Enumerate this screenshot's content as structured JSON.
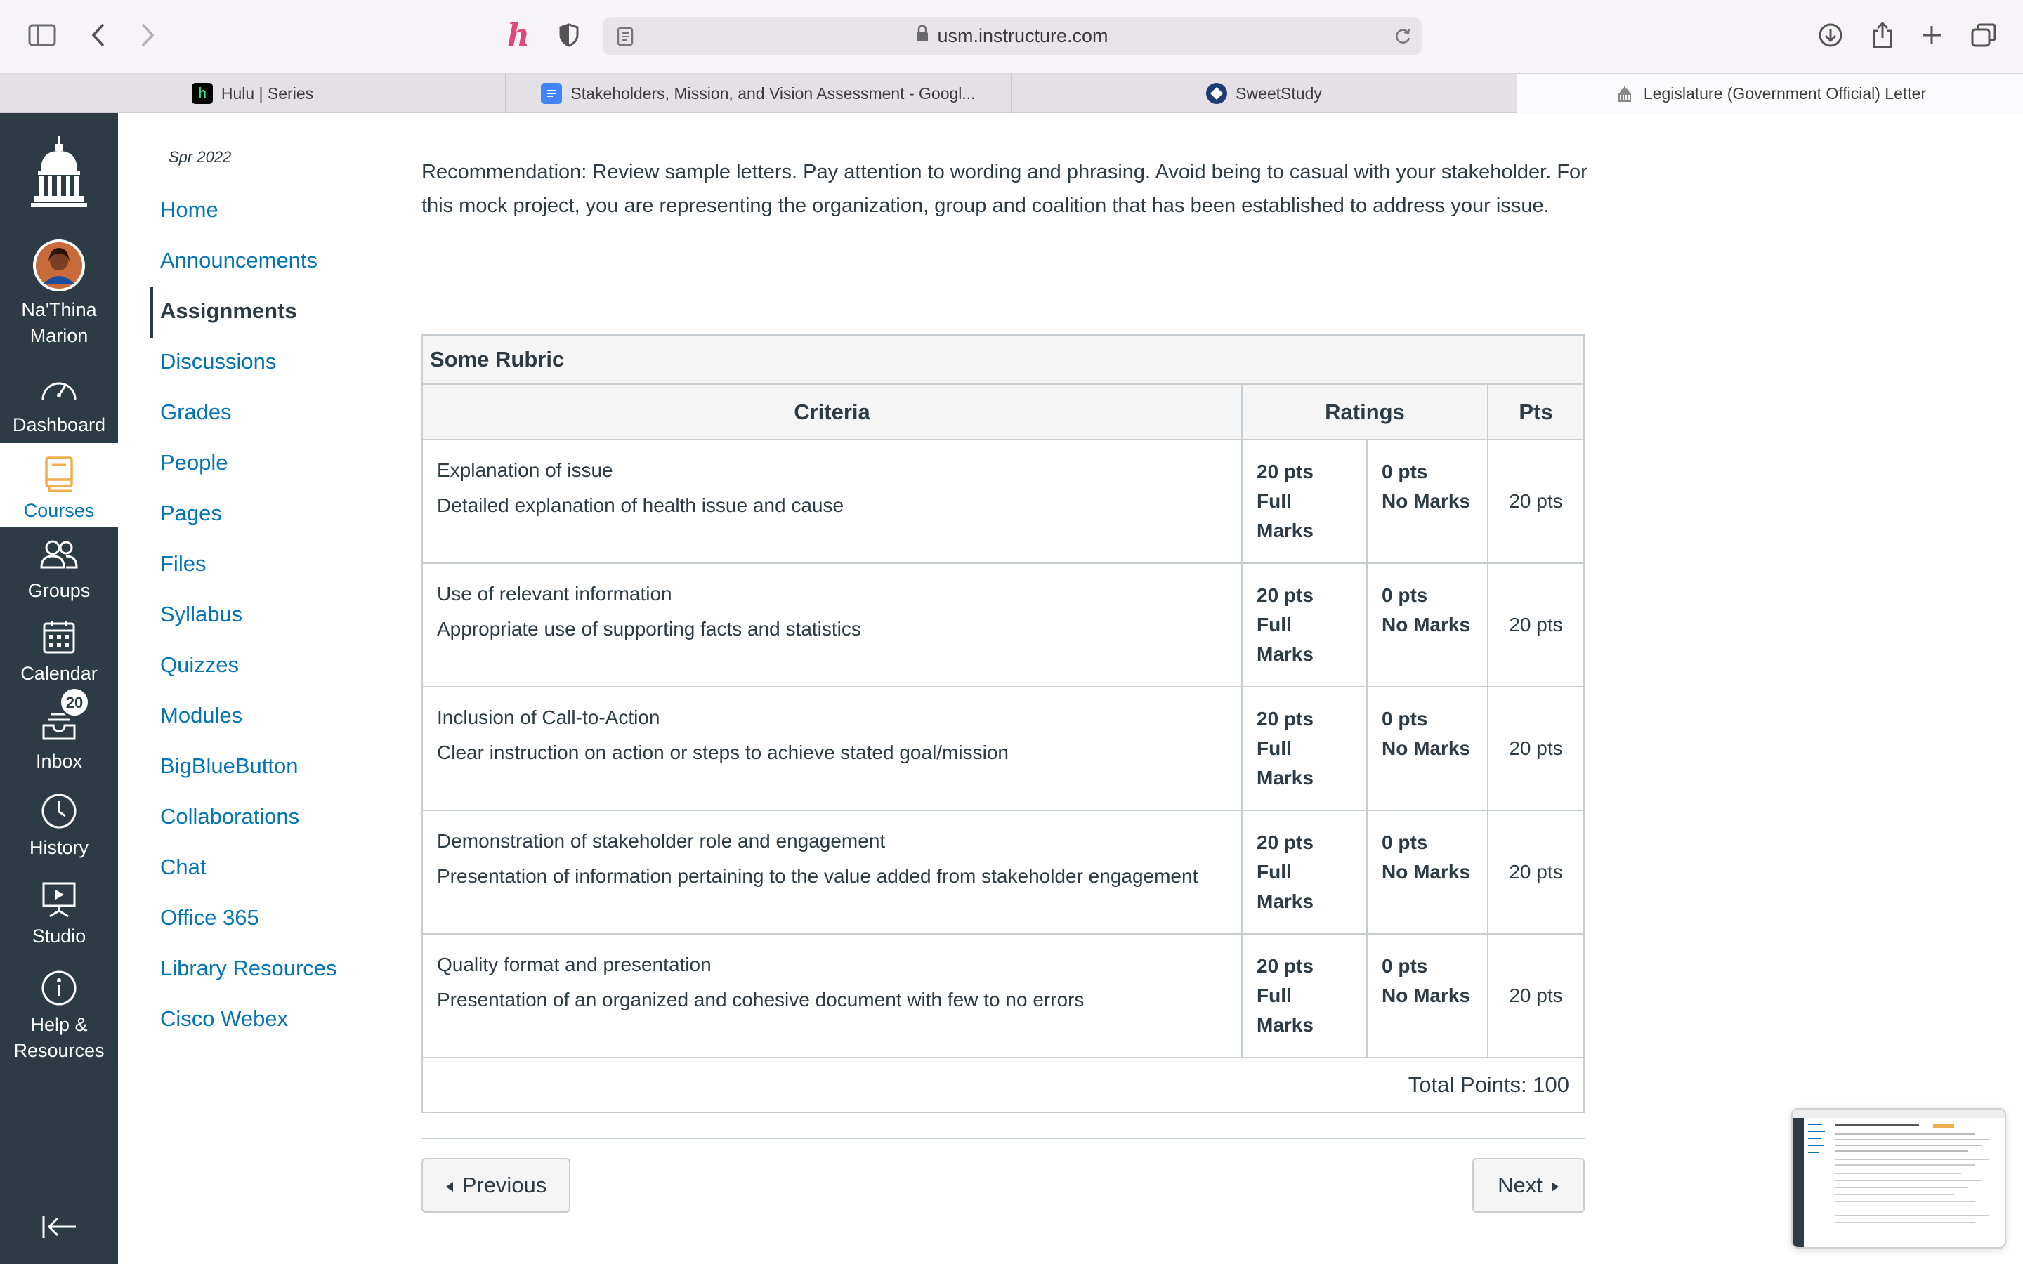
{
  "browser": {
    "url": "usm.instructure.com",
    "tabs": [
      {
        "title": "Hulu | Series",
        "favicon": "h",
        "favicon_color": "#1ce783"
      },
      {
        "title": "Stakeholders, Mission, and Vision Assessment - Googl...",
        "favicon": "docs",
        "favicon_color": "#4285f4"
      },
      {
        "title": "SweetStudy",
        "favicon": "sweetstudy",
        "favicon_color": "#1f3b73"
      },
      {
        "title": "Legislature (Government Official) Letter",
        "favicon": "capitol",
        "favicon_color": "#777777",
        "active": true
      }
    ]
  },
  "global_nav": {
    "user_name_line1": "Na'Thina",
    "user_name_line2": "Marion",
    "dashboard": "Dashboard",
    "courses": "Courses",
    "groups": "Groups",
    "calendar": "Calendar",
    "inbox": "Inbox",
    "inbox_badge": "20",
    "history": "History",
    "studio": "Studio",
    "help_line1": "Help &",
    "help_line2": "Resources"
  },
  "course_nav": {
    "term": "Spr 2022",
    "items": [
      "Home",
      "Announcements",
      "Assignments",
      "Discussions",
      "Grades",
      "People",
      "Pages",
      "Files",
      "Syllabus",
      "Quizzes",
      "Modules",
      "BigBlueButton",
      "Collaborations",
      "Chat",
      "Office 365",
      "Library Resources",
      "Cisco Webex"
    ],
    "active": "Assignments"
  },
  "content": {
    "recommendation": "Recommendation:  Review sample letters. Pay attention to wording and phrasing.  Avoid being to casual with your stakeholder. For this mock project, you are representing the organization, group and coalition that has been established to address your issue."
  },
  "rubric": {
    "title": "Some Rubric",
    "headers": {
      "criteria": "Criteria",
      "ratings": "Ratings",
      "pts": "Pts"
    },
    "rows": [
      {
        "criterion": "Explanation of issue",
        "description": "Detailed explanation of health issue and cause",
        "r1_pts": "20 pts",
        "r1_label": "Full Marks",
        "r2_pts": "0 pts",
        "r2_label": "No Marks",
        "pts": "20 pts"
      },
      {
        "criterion": "Use of relevant information",
        "description": "Appropriate use of supporting facts and statistics",
        "r1_pts": "20 pts",
        "r1_label": "Full Marks",
        "r2_pts": "0 pts",
        "r2_label": "No Marks",
        "pts": "20 pts"
      },
      {
        "criterion": "Inclusion of Call-to-Action",
        "description": "Clear instruction on action or steps to achieve stated goal/mission",
        "r1_pts": "20 pts",
        "r1_label": "Full Marks",
        "r2_pts": "0 pts",
        "r2_label": "No Marks",
        "pts": "20 pts"
      },
      {
        "criterion": "Demonstration of stakeholder role and engagement",
        "description": "Presentation of information pertaining to the value added from stakeholder engagement",
        "r1_pts": "20 pts",
        "r1_label": "Full Marks",
        "r2_pts": "0 pts",
        "r2_label": "No Marks",
        "pts": "20 pts"
      },
      {
        "criterion": "Quality format and presentation",
        "description": "Presentation of an organized and cohesive document with few to no errors",
        "r1_pts": "20 pts",
        "r1_label": "Full Marks",
        "r2_pts": "0 pts",
        "r2_label": "No Marks",
        "pts": "20 pts"
      }
    ],
    "total": "Total Points: 100"
  },
  "pager": {
    "previous": "Previous",
    "next": "Next"
  },
  "colors": {
    "nav_bg": "#2d3b45",
    "link": "#0374b5",
    "courses_icon": "#f0ad4e"
  }
}
